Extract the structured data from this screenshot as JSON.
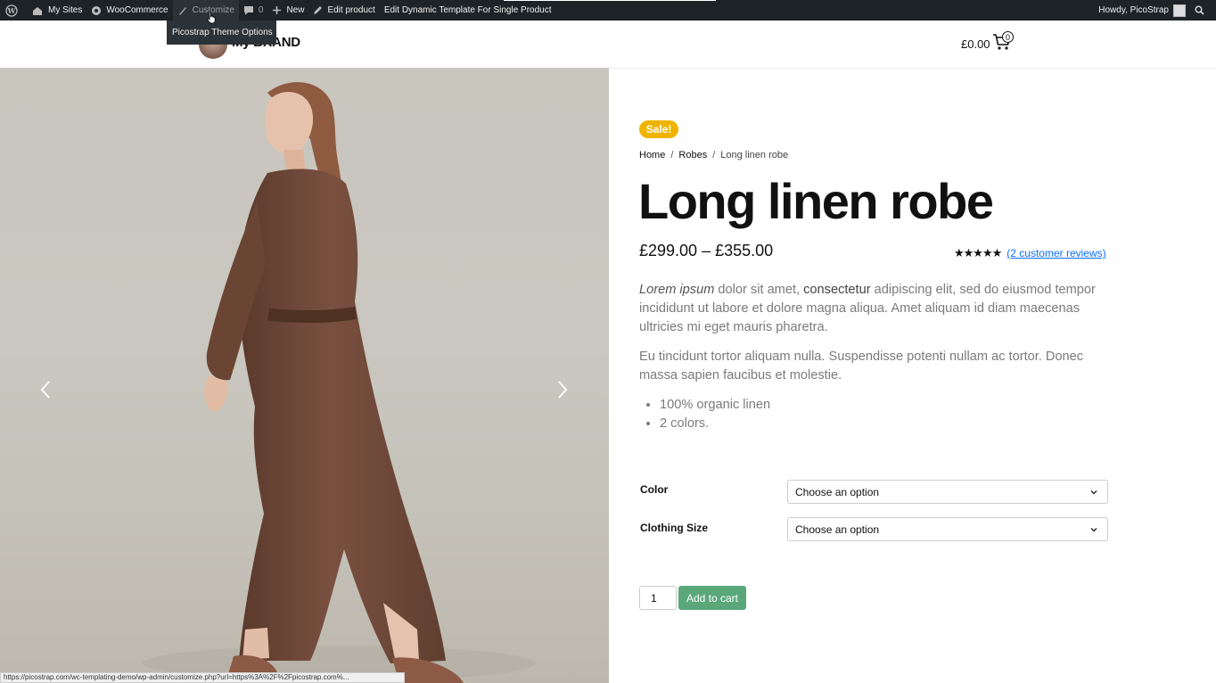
{
  "admin_bar": {
    "my_sites": "My Sites",
    "woocommerce": "WooCommerce",
    "customize": "Customize",
    "comments_count": "0",
    "new": "New",
    "edit_product": "Edit product",
    "edit_template": "Edit Dynamic Template For Single Product",
    "howdy": "Howdy, PicoStrap"
  },
  "tooltip": {
    "text": "Picostrap Theme Options"
  },
  "header": {
    "brand": "My BRAND",
    "cart_total": "£0.00",
    "cart_count": "0"
  },
  "product": {
    "sale_badge": "Sale!",
    "breadcrumb": {
      "home": "Home",
      "category": "Robes",
      "current": "Long linen robe"
    },
    "title": "Long linen robe",
    "price": "£299.00 – £355.00",
    "rating": {
      "stars": "★★★★★",
      "value_out_of_5": 5,
      "reviews_link": "(2 customer reviews)"
    },
    "description": {
      "p1_em": "Lorem ipsum",
      "p1_a": " dolor sit amet, ",
      "p1_b": "consectetur",
      "p1_c": " adipiscing elit, sed do eiusmod tempor incididunt ut labore et dolore magna aliqua. Amet aliquam id diam maecenas ultricies mi eget mauris pharetra.",
      "p2": "Eu tincidunt tortor aliquam nulla. Suspendisse potenti nullam ac tortor. Donec massa sapien faucibus et molestie.",
      "features": [
        "100% organic linen",
        "2 colors."
      ]
    },
    "variations": {
      "color_label": "Color",
      "color_value": "Choose an option",
      "size_label": "Clothing Size",
      "size_value": "Choose an option"
    },
    "quantity": "1",
    "add_to_cart": "Add to cart"
  },
  "status_bar": {
    "url": "https://picostrap.com/wc-templating-demo/wp-admin/customize.php?url=https%3A%2F%2Fpicostrap.com%..."
  },
  "colors": {
    "admin_bar_bg": "#1d2327",
    "sale_badge": "#f0b400",
    "add_to_cart": "#5aa87a",
    "link": "#0d6efd"
  }
}
